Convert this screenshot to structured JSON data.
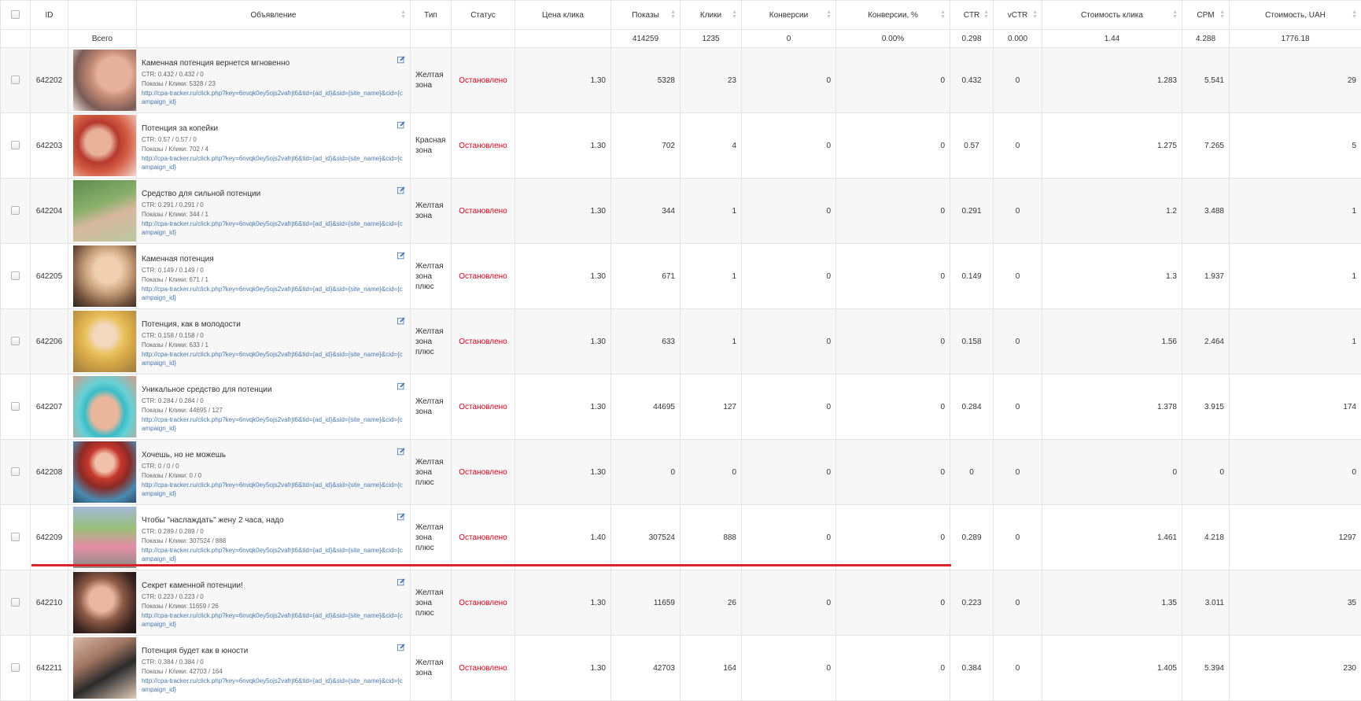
{
  "headers": {
    "id": "ID",
    "ad": "Объявление",
    "type": "Тип",
    "status": "Статус",
    "price": "Цена клика",
    "impressions": "Показы",
    "clicks": "Клики",
    "conversions": "Конверсии",
    "conversions_pct": "Конверсии, %",
    "ctr": "CTR",
    "vctr": "vCTR",
    "click_cost": "Стоимость клика",
    "cpm": "CPM",
    "cost": "Стоимость, UAH"
  },
  "totals": {
    "label": "Всего",
    "impressions": "414259",
    "clicks": "1235",
    "conversions": "0",
    "conversions_pct": "0.00%",
    "ctr": "0.298",
    "vctr": "0.000",
    "click_cost": "1.44",
    "cpm": "4.288",
    "cost": "1776.18"
  },
  "link_text": "http://cpa-tracker.ru/click.php?key=6nvqk0ey5ojs2vafrjt6&tid={ad_id}&sid={site_name}&cid={campaign_id}",
  "rows": [
    {
      "id": "642202",
      "title": "Каменная потенция вернется мгновенно",
      "ctr_line": "CTR: 0.432 / 0.432 / 0",
      "views_line": "Показы / Клики: 5328 / 23",
      "type": "Желтая зона",
      "status": "Остановлено",
      "price": "1.30",
      "impressions": "5328",
      "clicks": "23",
      "conversions": "0",
      "conversions_pct": "0",
      "ctr": "0.432",
      "vctr": "0",
      "click_cost": "1.283",
      "cpm": "5.541",
      "cost": "29"
    },
    {
      "id": "642203",
      "title": "Потенция за копейки",
      "ctr_line": "CTR: 0.57 / 0.57 / 0",
      "views_line": "Показы / Клики: 702 / 4",
      "type": "Красная зона",
      "status": "Остановлено",
      "price": "1.30",
      "impressions": "702",
      "clicks": "4",
      "conversions": "0",
      "conversions_pct": "0",
      "ctr": "0.57",
      "vctr": "0",
      "click_cost": "1.275",
      "cpm": "7.265",
      "cost": "5"
    },
    {
      "id": "642204",
      "title": "Средство для сильной потенции",
      "ctr_line": "CTR: 0.291 / 0.291 / 0",
      "views_line": "Показы / Клики: 344 / 1",
      "type": "Желтая зона",
      "status": "Остановлено",
      "price": "1.30",
      "impressions": "344",
      "clicks": "1",
      "conversions": "0",
      "conversions_pct": "0",
      "ctr": "0.291",
      "vctr": "0",
      "click_cost": "1.2",
      "cpm": "3.488",
      "cost": "1"
    },
    {
      "id": "642205",
      "title": "Каменная потенция",
      "ctr_line": "CTR: 0.149 / 0.149 / 0",
      "views_line": "Показы / Клики: 671 / 1",
      "type": "Желтая зона плюс",
      "status": "Остановлено",
      "price": "1.30",
      "impressions": "671",
      "clicks": "1",
      "conversions": "0",
      "conversions_pct": "0",
      "ctr": "0.149",
      "vctr": "0",
      "click_cost": "1.3",
      "cpm": "1.937",
      "cost": "1"
    },
    {
      "id": "642206",
      "title": "Потенция, как в молодости",
      "ctr_line": "CTR: 0.158 / 0.158 / 0",
      "views_line": "Показы / Клики: 633 / 1",
      "type": "Желтая зона плюс",
      "status": "Остановлено",
      "price": "1.30",
      "impressions": "633",
      "clicks": "1",
      "conversions": "0",
      "conversions_pct": "0",
      "ctr": "0.158",
      "vctr": "0",
      "click_cost": "1.56",
      "cpm": "2.464",
      "cost": "1"
    },
    {
      "id": "642207",
      "title": "Уникальное средство для потенции",
      "ctr_line": "CTR: 0.284 / 0.284 / 0",
      "views_line": "Показы / Клики: 44695 / 127",
      "type": "Желтая зона",
      "status": "Остановлено",
      "price": "1.30",
      "impressions": "44695",
      "clicks": "127",
      "conversions": "0",
      "conversions_pct": "0",
      "ctr": "0.284",
      "vctr": "0",
      "click_cost": "1.378",
      "cpm": "3.915",
      "cost": "174"
    },
    {
      "id": "642208",
      "title": "Хочешь, но не можешь",
      "ctr_line": "CTR: 0 / 0 / 0",
      "views_line": "Показы / Клики: 0 / 0",
      "type": "Желтая зона плюс",
      "status": "Остановлено",
      "price": "1.30",
      "impressions": "0",
      "clicks": "0",
      "conversions": "0",
      "conversions_pct": "0",
      "ctr": "0",
      "vctr": "0",
      "click_cost": "0",
      "cpm": "0",
      "cost": "0"
    },
    {
      "id": "642209",
      "title": "Чтобы \"наслаждать\" жену 2 часа, надо",
      "ctr_line": "CTR: 0.289 / 0.289 / 0",
      "views_line": "Показы / Клики: 307524 / 888",
      "type": "Желтая зона плюс",
      "status": "Остановлено",
      "price": "1.40",
      "impressions": "307524",
      "clicks": "888",
      "conversions": "0",
      "conversions_pct": "0",
      "ctr": "0.289",
      "vctr": "0",
      "click_cost": "1.461",
      "cpm": "4.218",
      "cost": "1297"
    },
    {
      "id": "642210",
      "title": "Секрет каменной потенции!",
      "ctr_line": "CTR: 0.223 / 0.223 / 0",
      "views_line": "Показы / Клики: 11659 / 26",
      "type": "Желтая зона плюс",
      "status": "Остановлено",
      "price": "1.30",
      "impressions": "11659",
      "clicks": "26",
      "conversions": "0",
      "conversions_pct": "0",
      "ctr": "0.223",
      "vctr": "0",
      "click_cost": "1.35",
      "cpm": "3.011",
      "cost": "35"
    },
    {
      "id": "642211",
      "title": "Потенция будет как в юности",
      "ctr_line": "CTR: 0.384 / 0.384 / 0",
      "views_line": "Показы / Клики: 42703 / 164",
      "type": "Желтая зона",
      "status": "Остановлено",
      "price": "1.30",
      "impressions": "42703",
      "clicks": "164",
      "conversions": "0",
      "conversions_pct": "0",
      "ctr": "0.384",
      "vctr": "0",
      "click_cost": "1.405",
      "cpm": "5.394",
      "cost": "230"
    }
  ],
  "icons": {
    "select_all": "checkbox-icon",
    "sort": "sort-arrows-icon",
    "edit": "edit-icon"
  },
  "colors": {
    "status": "#d0021b",
    "link": "#4a78b0",
    "divider": "#d9232d"
  }
}
